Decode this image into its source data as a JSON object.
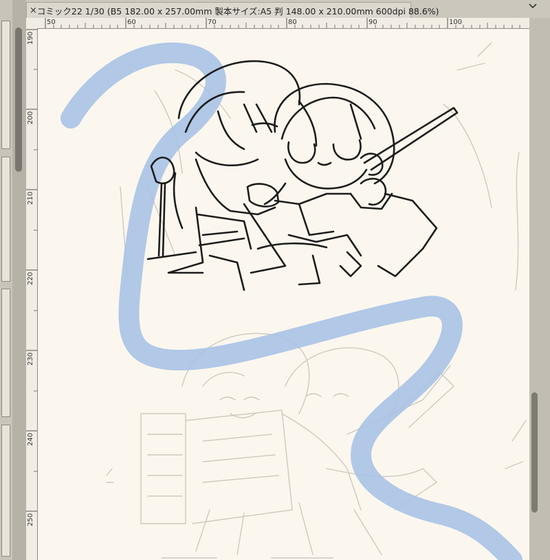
{
  "document_tab": {
    "close_icon": "close-icon",
    "title": "コミック22 1/30 (B5 182.00 x 257.00mm 製本サイズ:A5 判 148.00 x 210.00mm 600dpi 88.6%)",
    "menu_icon": "chevron-down-icon"
  },
  "ruler": {
    "horizontal_labels": [
      "50",
      "60",
      "70",
      "80",
      "90",
      "100"
    ],
    "vertical_labels": [
      "190",
      "200",
      "210",
      "220",
      "230",
      "240",
      "250"
    ]
  },
  "colors": {
    "canvas": "#fbf7ee",
    "guide_stroke": "#a9c2e6",
    "lineart": "#1a1a1a",
    "sketch": "#cdc7bd"
  }
}
